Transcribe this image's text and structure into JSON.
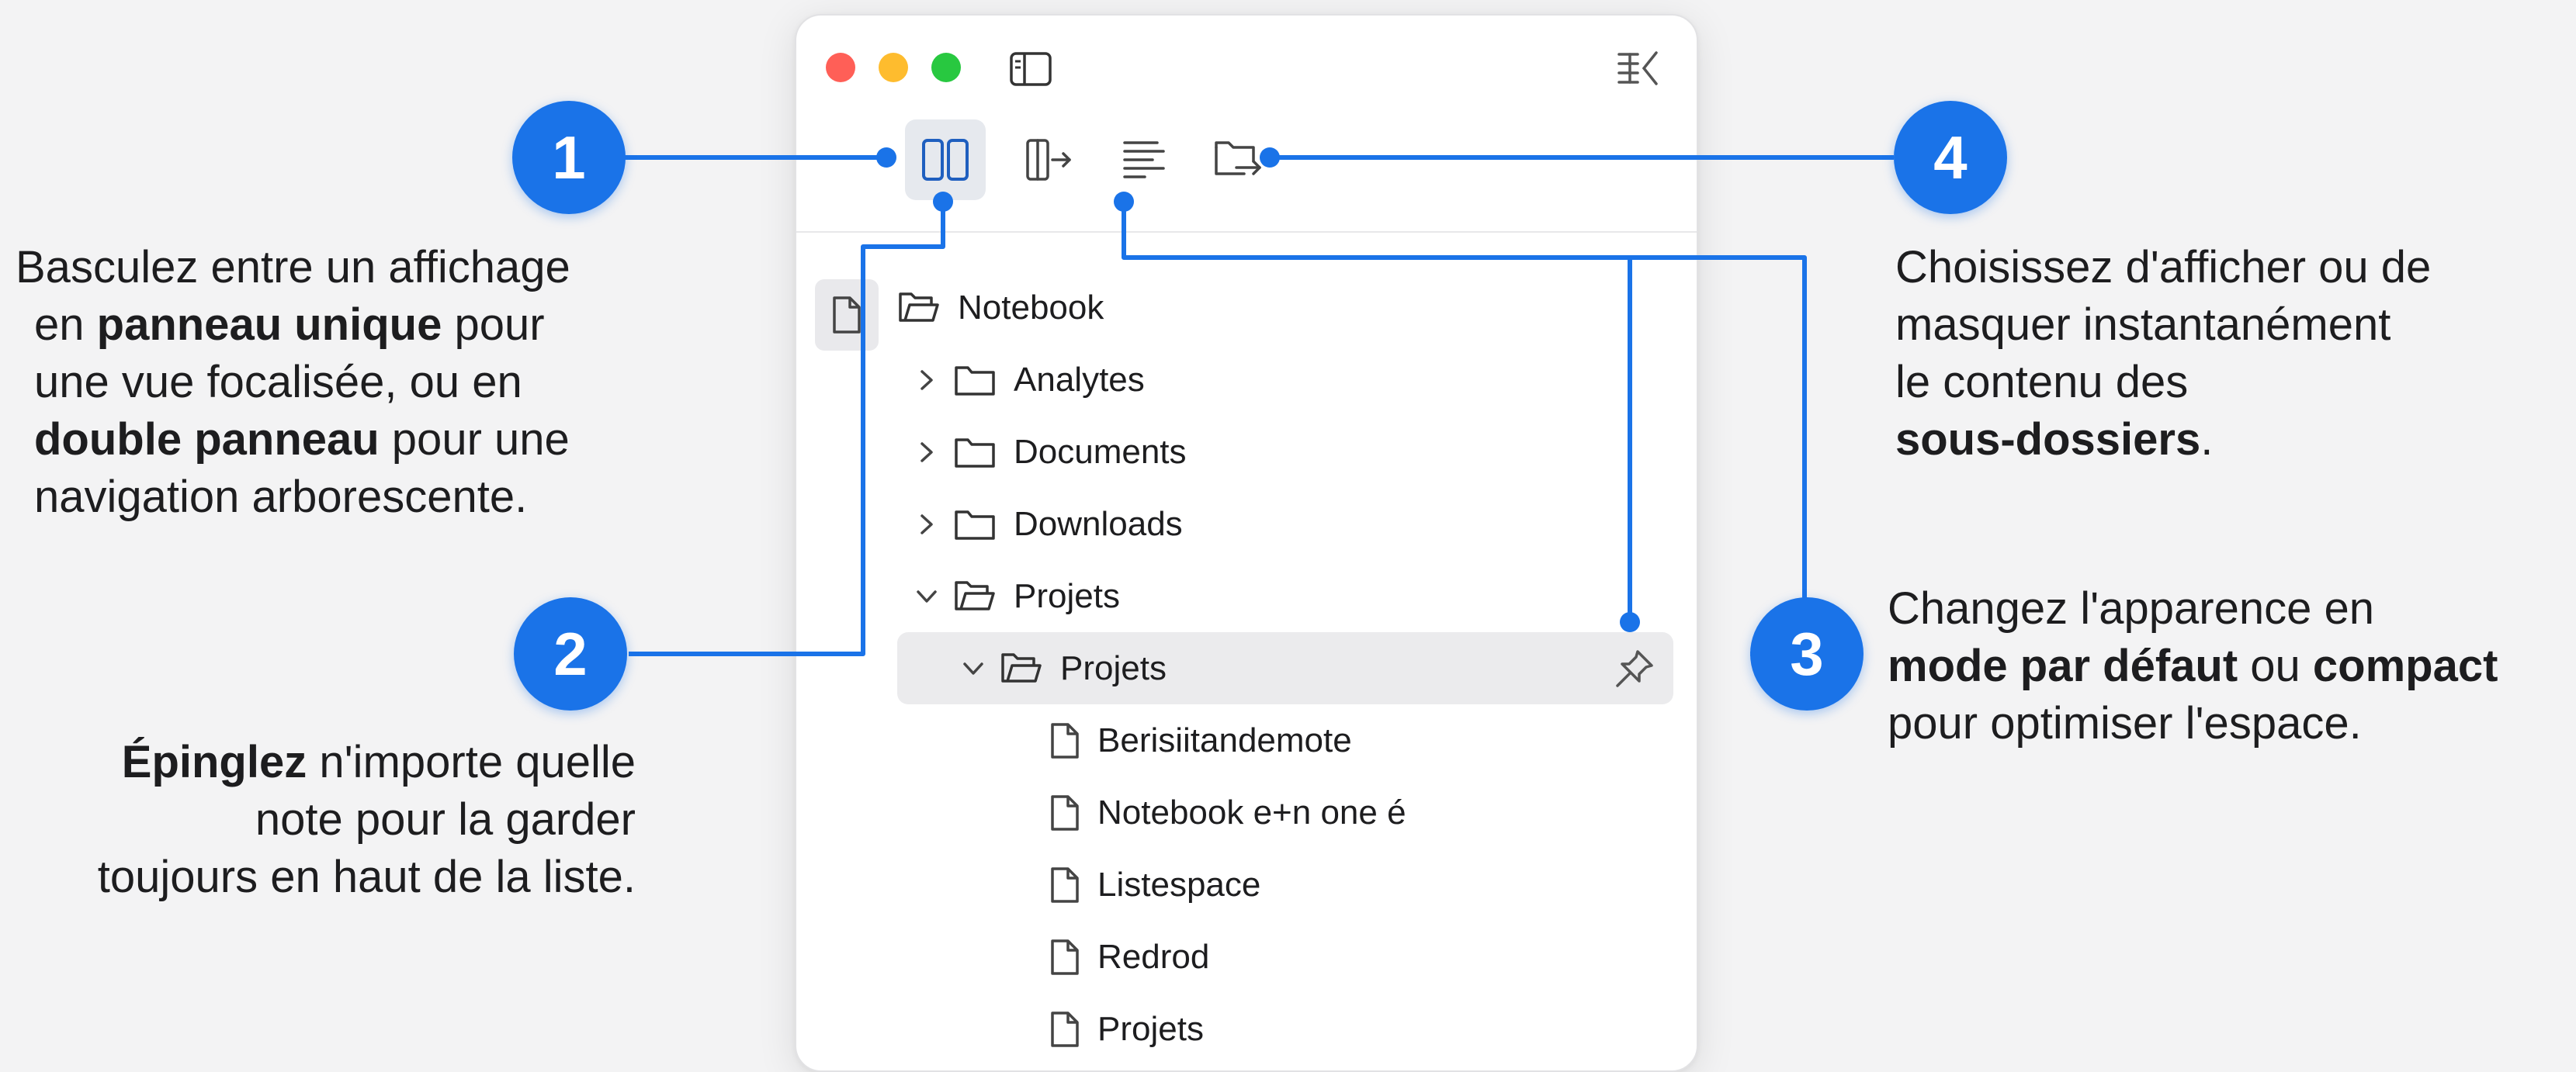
{
  "window": {
    "tree": [
      {
        "label": "Notebook",
        "icon": "folder-open-icon",
        "chevron": ""
      },
      {
        "label": "Analytes",
        "icon": "folder-icon",
        "chevron": "right"
      },
      {
        "label": "Documents",
        "icon": "folder-icon",
        "chevron": "right"
      },
      {
        "label": "Downloads",
        "icon": "folder-icon",
        "chevron": "right"
      },
      {
        "label": "Projets",
        "icon": "folder-open-icon",
        "chevron": "down"
      },
      {
        "label": "Projets",
        "icon": "folder-open-icon",
        "chevron": "down",
        "selected": true
      },
      {
        "label": "Berisiitandemote",
        "icon": "file-icon"
      },
      {
        "label": "Notebook e+n one é",
        "icon": "file-icon"
      },
      {
        "label": "Listespace",
        "icon": "file-icon"
      },
      {
        "label": "Redrod",
        "icon": "file-icon"
      },
      {
        "label": "Projets",
        "icon": "file-icon"
      }
    ]
  },
  "badges": [
    "1",
    "2",
    "3",
    "4"
  ],
  "annotations": {
    "a1": {
      "l1": "Basculez entre un affichage",
      "l2_pre": "en ",
      "l2_b": "panneau unique",
      "l2_post": " pour",
      "l3": "une vue focalisée, ou en",
      "l4_b": "double panneau",
      "l4_post": " pour une",
      "l5": "navigation arborescente."
    },
    "a2": {
      "l1_b": "Épinglez",
      "l1_post": " n'importe quelle",
      "l2": "note pour la garder",
      "l3": "toujours en haut de la liste."
    },
    "a3": {
      "l1": "Changez l'apparence en",
      "l2_b1": "mode par défaut",
      "l2_mid": " ou ",
      "l2_b2": "compact",
      "l3": "pour optimiser l'espace."
    },
    "a4": {
      "l1": "Choisissez d'afficher ou de",
      "l2": "masquer instantanément",
      "l3": "le contenu des",
      "l4_b": "sous-dossiers",
      "l4_post": "."
    }
  },
  "colors": {
    "accent": "#1a73e8",
    "icon_blue": "#1f5fbf",
    "background": "#f3f3f4"
  }
}
